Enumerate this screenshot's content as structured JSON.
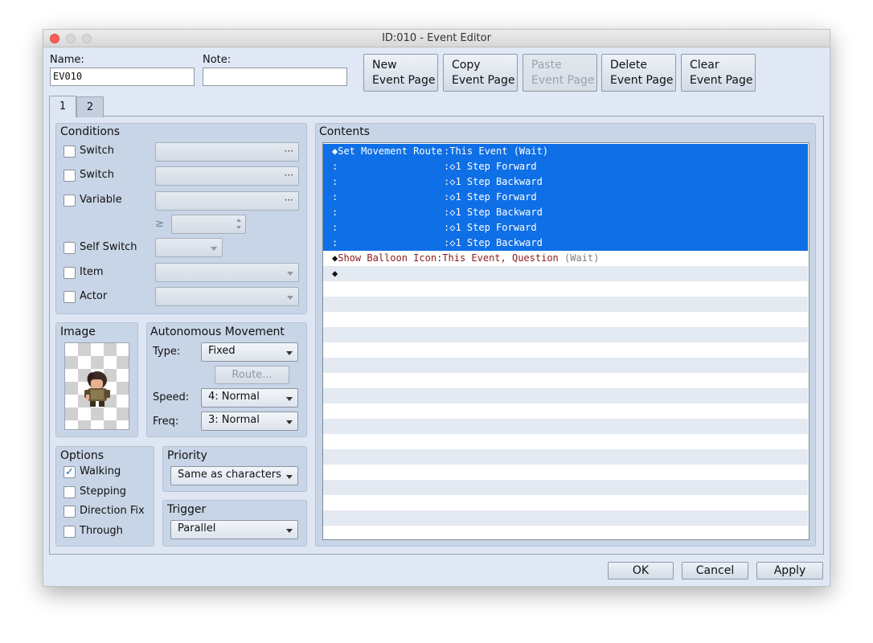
{
  "window": {
    "title": "ID:010 - Event Editor"
  },
  "header": {
    "name_label": "Name:",
    "name_value": "EV010",
    "note_label": "Note:",
    "note_value": ""
  },
  "toolbar": {
    "new": {
      "line1": "New",
      "line2": "Event Page",
      "enabled": true
    },
    "copy": {
      "line1": "Copy",
      "line2": "Event Page",
      "enabled": true
    },
    "paste": {
      "line1": "Paste",
      "line2": "Event Page",
      "enabled": false
    },
    "delete": {
      "line1": "Delete",
      "line2": "Event Page",
      "enabled": true
    },
    "clear": {
      "line1": "Clear",
      "line2": "Event Page",
      "enabled": true
    }
  },
  "tabs": [
    {
      "label": "1",
      "active": true
    },
    {
      "label": "2",
      "active": false
    }
  ],
  "conditions": {
    "title": "Conditions",
    "switch1_label": "Switch",
    "switch2_label": "Switch",
    "variable_label": "Variable",
    "gte_symbol": "≥",
    "self_switch_label": "Self Switch",
    "item_label": "Item",
    "actor_label": "Actor",
    "ellipsis": "···"
  },
  "image": {
    "title": "Image",
    "sprite_icon": "character-sprite-icon"
  },
  "movement": {
    "title": "Autonomous Movement",
    "type_label": "Type:",
    "type_value": "Fixed",
    "route_button": "Route...",
    "speed_label": "Speed:",
    "speed_value": "4: Normal",
    "freq_label": "Freq:",
    "freq_value": "3: Normal"
  },
  "options": {
    "title": "Options",
    "walking": {
      "label": "Walking",
      "checked": true
    },
    "stepping": {
      "label": "Stepping",
      "checked": false
    },
    "direction_fix": {
      "label": "Direction Fix",
      "checked": false
    },
    "through": {
      "label": "Through",
      "checked": false
    },
    "checkmark": "✓"
  },
  "priority": {
    "title": "Priority",
    "value": "Same as characters"
  },
  "trigger": {
    "title": "Trigger",
    "value": "Parallel"
  },
  "contents": {
    "title": "Contents",
    "rows": [
      {
        "c1": "◆Set Movement Route",
        "c2": ":This Event (Wait)",
        "selected": true
      },
      {
        "c1": ":",
        "c2": ":◇1 Step Forward",
        "selected": true
      },
      {
        "c1": ":",
        "c2": ":◇1 Step Backward",
        "selected": true
      },
      {
        "c1": ":",
        "c2": ":◇1 Step Forward",
        "selected": true
      },
      {
        "c1": ":",
        "c2": ":◇1 Step Backward",
        "selected": true
      },
      {
        "c1": ":",
        "c2": ":◇1 Step Forward",
        "selected": true
      },
      {
        "c1": ":",
        "c2": ":◇1 Step Backward",
        "selected": true
      },
      {
        "c1a": "◆",
        "c1b": "Show Balloon Icon",
        "c1c": ":This Event, Question",
        "c1d": "(Wait)",
        "selected": false
      },
      {
        "c1": "◆",
        "selected": false
      }
    ]
  },
  "footer": {
    "ok": "OK",
    "cancel": "Cancel",
    "apply": "Apply"
  },
  "colors": {
    "selection": "#0f6fe6",
    "window_bg": "#dfe8f4",
    "group_bg": "#c8d5e6",
    "command_text": "#8b1a1a"
  }
}
